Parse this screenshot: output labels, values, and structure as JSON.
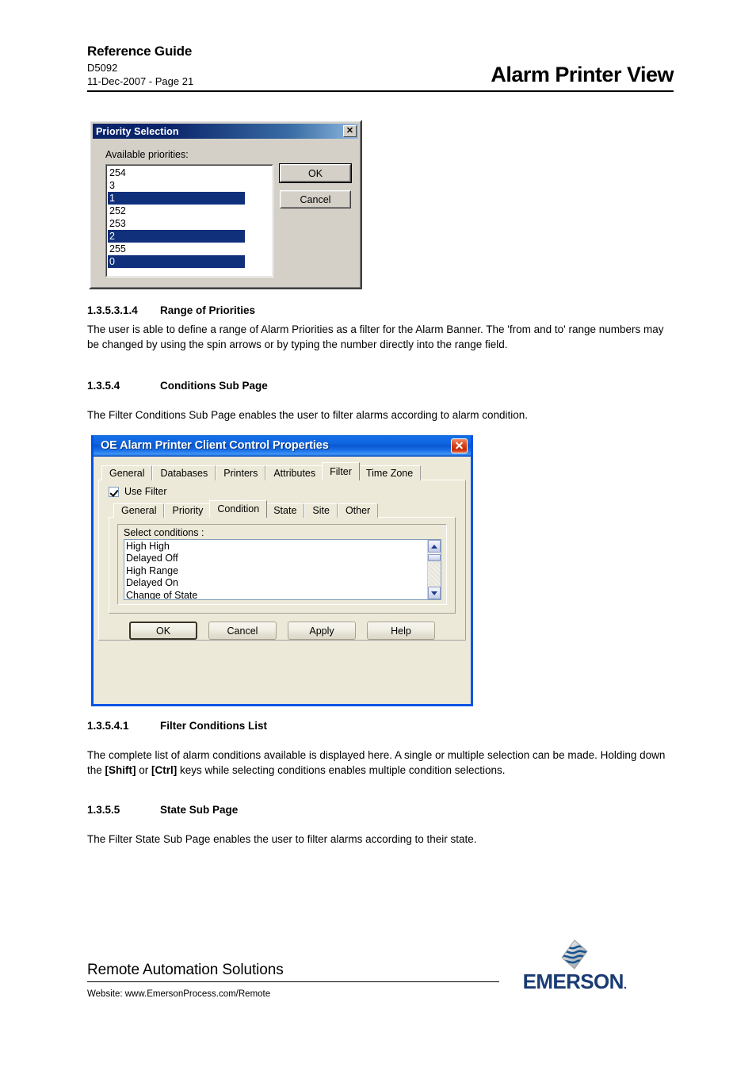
{
  "header": {
    "title": "Reference Guide",
    "doc_number": "D5092",
    "date_page": "11-Dec-2007 - Page 21",
    "right_title": "Alarm Printer View"
  },
  "priority_dialog": {
    "title": "Priority Selection",
    "close_label": "✕",
    "list_label": "Available priorities:",
    "items": [
      {
        "value": "254",
        "selected": false
      },
      {
        "value": "3",
        "selected": false
      },
      {
        "value": "1",
        "selected": true
      },
      {
        "value": "252",
        "selected": false
      },
      {
        "value": "253",
        "selected": false
      },
      {
        "value": "2",
        "selected": true
      },
      {
        "value": "255",
        "selected": false
      },
      {
        "value": "0",
        "selected": true
      }
    ],
    "ok_label": "OK",
    "cancel_label": "Cancel",
    "selection_color": "#10307c",
    "titlebar_color": "#0a246a"
  },
  "sections": [
    {
      "number": "1.3.5.3.1.4",
      "title": "Range of Priorities",
      "body": "The user is able to define a range of Alarm Priorities as a filter for the Alarm Banner. The 'from and to' range numbers may be changed by using the spin arrows or by typing the number directly into the range field."
    },
    {
      "number": "1.3.5.4",
      "title": "Conditions Sub Page",
      "body": "The Filter Conditions Sub Page enables the user to filter alarms according to alarm condition."
    },
    {
      "number": "1.3.5.4.1",
      "title": "Filter Conditions List",
      "body_part1": "The complete list of alarm conditions available is displayed here. A single or multiple selection can be made. Holding down the ",
      "body_bold1": "[Shift]",
      "body_part2": " or ",
      "body_bold2": "[Ctrl]",
      "body_part3": " keys while selecting conditions enables multiple condition selections."
    },
    {
      "number": "1.3.5.5",
      "title": "State Sub Page",
      "body": "The Filter State Sub Page enables the user to filter alarms according to their state."
    }
  ],
  "properties_dialog": {
    "title": "OE Alarm Printer Client Control Properties",
    "close_label": "close-icon",
    "titlebar_color": "#0a58d0",
    "outer_tabs": [
      {
        "label": "General",
        "active": false
      },
      {
        "label": "Databases",
        "active": false
      },
      {
        "label": "Printers",
        "active": false
      },
      {
        "label": "Attributes",
        "active": false
      },
      {
        "label": "Filter",
        "active": true
      },
      {
        "label": "Time Zone",
        "active": false
      }
    ],
    "use_filter": {
      "label": "Use Filter",
      "checked": true
    },
    "inner_tabs": [
      {
        "label": "General",
        "active": false
      },
      {
        "label": "Priority",
        "active": false
      },
      {
        "label": "Condition",
        "active": true
      },
      {
        "label": "State",
        "active": false
      },
      {
        "label": "Site",
        "active": false
      },
      {
        "label": "Other",
        "active": false
      }
    ],
    "conditions_label": "Select conditions :",
    "conditions": [
      "High High",
      "Delayed Off",
      "High Range",
      "Delayed On",
      "Change of State"
    ],
    "buttons": [
      {
        "label": "OK",
        "default": true
      },
      {
        "label": "Cancel",
        "default": false
      },
      {
        "label": "Apply",
        "default": false
      },
      {
        "label": "Help",
        "default": false
      }
    ]
  },
  "footer": {
    "company": "Remote Automation Solutions",
    "website": "Website:  www.EmersonProcess.com/Remote",
    "logo_word": "EMERSON",
    "logo_dot": ".",
    "logo_color": "#1a3b73"
  }
}
